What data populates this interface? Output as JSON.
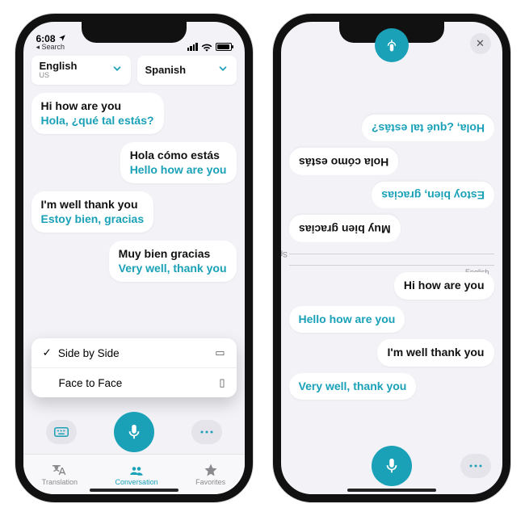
{
  "colors": {
    "accent": "#1aa1b8",
    "bg": "#f2f2f7"
  },
  "phone1": {
    "status": {
      "time": "6:08",
      "back": "Search",
      "location_on": true
    },
    "lang": {
      "from": {
        "name": "English",
        "sub": "US"
      },
      "to": {
        "name": "Spanish",
        "sub": ""
      }
    },
    "messages": [
      {
        "side": "left",
        "src": "Hi how are you",
        "tr": "Hola, ¿qué tal estás?"
      },
      {
        "side": "right",
        "src": "Hola cómo estás",
        "tr": "Hello how are you"
      },
      {
        "side": "left",
        "src": "I'm well thank you",
        "tr": "Estoy bien, gracias"
      },
      {
        "side": "right",
        "src": "Muy bien gracias",
        "tr": "Very well, thank you"
      }
    ],
    "popup": {
      "items": [
        {
          "label": "Side by Side",
          "checked": true,
          "icon": "side-by-side-icon"
        },
        {
          "label": "Face to Face",
          "checked": false,
          "icon": "face-to-face-icon"
        }
      ]
    },
    "tabs": [
      {
        "label": "Translation",
        "icon": "translation-icon",
        "active": false
      },
      {
        "label": "Conversation",
        "icon": "conversation-icon",
        "active": true
      },
      {
        "label": "Favorites",
        "icon": "favorites-icon",
        "active": false
      }
    ]
  },
  "phone2": {
    "lang_top": "Spanish / Español",
    "lang_bot": "English",
    "top_messages": [
      {
        "side": "right",
        "cls": "src",
        "text": "Muy bien gracias"
      },
      {
        "side": "left",
        "cls": "tr",
        "text": "Estoy bien, gracias"
      },
      {
        "side": "right",
        "cls": "src",
        "text": "Hola cómo estás"
      },
      {
        "side": "left",
        "cls": "tr",
        "text": "Hola, ¿qué tal estás?"
      }
    ],
    "bot_messages": [
      {
        "side": "right",
        "cls": "src",
        "text": "Hi how are you"
      },
      {
        "side": "left",
        "cls": "tr",
        "text": "Hello how are you"
      },
      {
        "side": "right",
        "cls": "src",
        "text": "I'm well thank you"
      },
      {
        "side": "left",
        "cls": "tr",
        "text": "Very well, thank you"
      }
    ]
  }
}
